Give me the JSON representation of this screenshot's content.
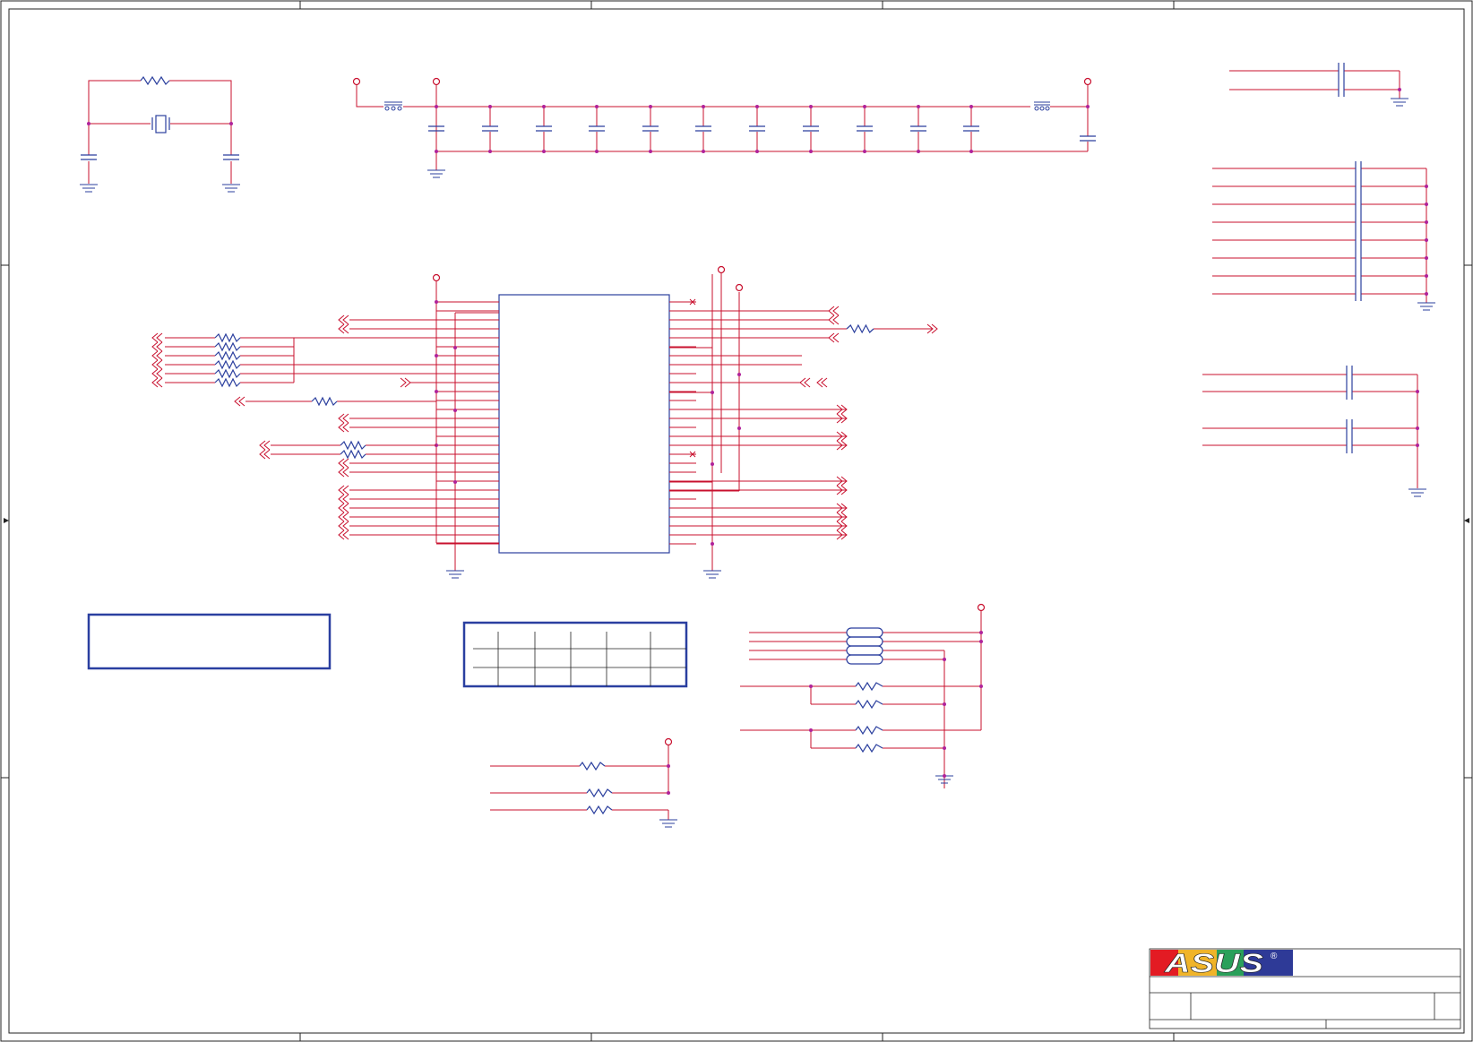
{
  "title_block": {
    "brand": "ASUS",
    "registered_mark": "®"
  },
  "colors": {
    "wire": "#c8102e",
    "component": "#2b3f9e",
    "junction": "#b0229a",
    "border": "#222222",
    "note_box": "#2a3fa0",
    "logo_red": "#e31b23",
    "logo_blue": "#2e3a97"
  }
}
